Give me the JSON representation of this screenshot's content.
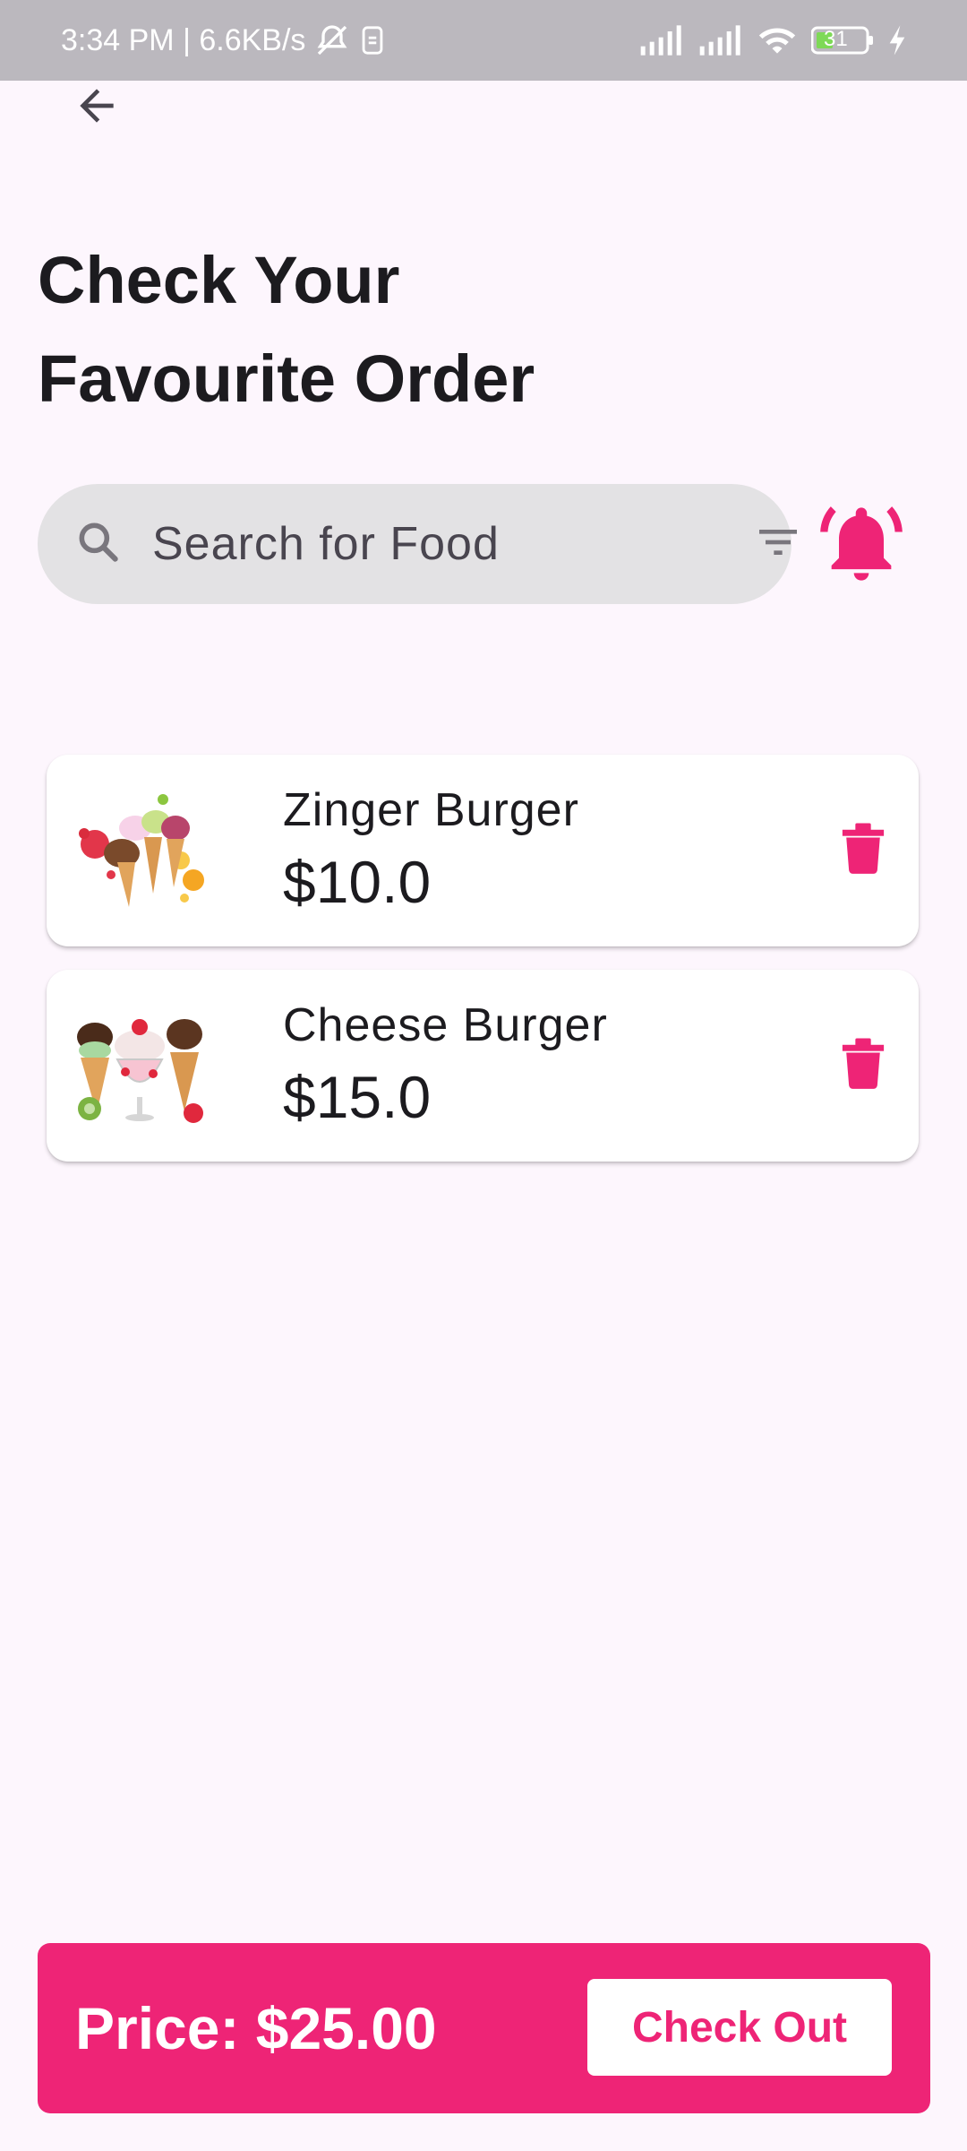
{
  "status_bar": {
    "time_speed": "3:34 PM | 6.6KB/s",
    "battery": "31"
  },
  "header": {
    "title": "Check Your\nFavourite Order",
    "back_icon": "arrow-left-icon"
  },
  "search": {
    "placeholder": "Search for Food",
    "value": "",
    "search_icon": "search-icon",
    "filter_icon": "filter-icon"
  },
  "notification_icon": "bell-icon",
  "orders": [
    {
      "name": "Zinger Burger",
      "price": "$10.0",
      "image": "ice-cream-cones-image"
    },
    {
      "name": "Cheese Burger",
      "price": "$15.0",
      "image": "ice-cream-sundae-image"
    }
  ],
  "checkout": {
    "total_label": "Price: $25.00",
    "button_label": "Check Out"
  },
  "colors": {
    "accent": "#ee2476",
    "background": "#fdf6fd",
    "search_bg": "#e3e2e4",
    "status_bar": "#bbb8be"
  }
}
